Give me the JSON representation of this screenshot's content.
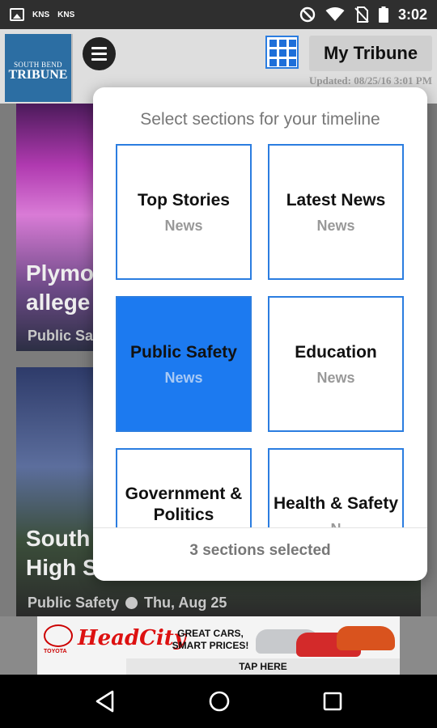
{
  "status_bar": {
    "left_icons": [
      "image-icon"
    ],
    "labels": [
      "KNS",
      "KNS"
    ],
    "right_icons": [
      "do-not-disturb-icon",
      "wifi-icon",
      "no-sim-icon",
      "battery-icon"
    ],
    "time": "3:02"
  },
  "app_bar": {
    "logo": {
      "line1": "SOUTH BEND",
      "line2": "TRIBUNE"
    },
    "menu_icon": "hamburger-icon",
    "grid_icon": "grid-icon",
    "my_tribune_label": "My Tribune",
    "updated_text": "Updated: 08/25/16 3:01 PM"
  },
  "feed": {
    "cards": [
      {
        "title_line1": "Plymo",
        "title_line2": "allege",
        "meta": "Public Sa"
      },
      {
        "title_line1": "South",
        "title_line2": "High S",
        "meta_section": "Public Safety",
        "meta_date": "Thu, Aug 25"
      }
    ]
  },
  "dialog": {
    "title": "Select sections for your timeline",
    "sections": [
      {
        "name": "Top Stories",
        "category": "News",
        "selected": false
      },
      {
        "name": "Latest News",
        "category": "News",
        "selected": false
      },
      {
        "name": "Public Safety",
        "category": "News",
        "selected": true
      },
      {
        "name": "Education",
        "category": "News",
        "selected": false
      },
      {
        "name": "Government & Politics",
        "category": "",
        "selected": false
      },
      {
        "name": "Health & Safety",
        "category": "N",
        "selected": false
      }
    ],
    "footer": "3 sections selected"
  },
  "ad_banner": {
    "toyota": "TOYOTA",
    "brand": "HeadCity",
    "slogan_line1": "GREAT CARS,",
    "slogan_line2": "SMART PRICES!",
    "cta": "TAP HERE"
  },
  "nav_bar": {
    "icons": [
      "back-icon",
      "home-icon",
      "recents-icon"
    ]
  },
  "colors": {
    "accent": "#1c7af0",
    "tile_border": "#2b7de0",
    "logo_bg": "#2c6ea3"
  }
}
